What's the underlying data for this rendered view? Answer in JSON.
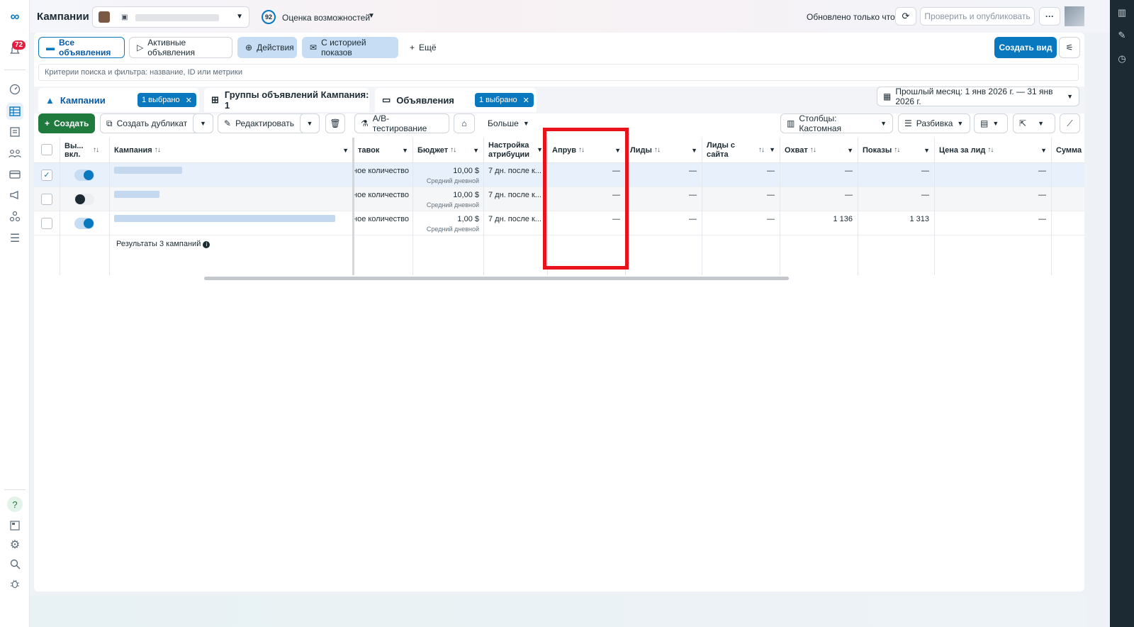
{
  "left_rail": {
    "notification_count": "72"
  },
  "topbar": {
    "title": "Кампании",
    "opportunity_score": "92",
    "opportunity_label": "Оценка возможностей",
    "updated_text": "Обновлено только что",
    "publish_label": "Проверить и опубликовать",
    "more_label": "···"
  },
  "filters": {
    "all_ads": "Все объявления",
    "active_ads": "Активные объявления",
    "actions": "Действия",
    "with_history": "С историей показов",
    "more": "Ещё",
    "create_view": "Создать вид",
    "search_placeholder": "Критерии поиска и фильтра: название, ID или метрики"
  },
  "level_tabs": {
    "campaigns": "Кампании",
    "campaigns_chip": "1 выбрано",
    "adsets": "Группы объявлений Кампания: 1",
    "ads": "Объявления",
    "ads_chip": "1 выбрано",
    "date_range": "Прошлый месяц: 1 янв 2026 г. — 31 янв 2026 г."
  },
  "toolbar": {
    "create": "Создать",
    "duplicate": "Создать дубликат",
    "edit": "Редактировать",
    "ab_test": "A/B-тестирование",
    "more": "Больше",
    "columns": "Столбцы: Кастомная",
    "breakdown": "Разбивка"
  },
  "table": {
    "headers": {
      "onoff": "Вы... вкл.",
      "campaign": "Кампания",
      "bid": "тавок",
      "budget": "Бюджет",
      "attribution": "Настройка атрибуции",
      "approve": "Апрув",
      "leads": "Лиды",
      "site_leads": "Лиды с сайта",
      "reach": "Охват",
      "impressions": "Показы",
      "cpl": "Цена за лид",
      "spend": "Сумма"
    },
    "rows": [
      {
        "bid": "ное количество",
        "budget": "10,00 $",
        "budget_sub": "Средний дневной",
        "attribution": "7 дн. после к...",
        "approve": "—",
        "leads": "—",
        "site_leads": "—",
        "reach": "—",
        "impressions": "—",
        "cpl": "—"
      },
      {
        "bid": "ное количество",
        "budget": "10,00 $",
        "budget_sub": "Средний дневной",
        "attribution": "7 дн. после к...",
        "approve": "—",
        "leads": "—",
        "site_leads": "—",
        "reach": "—",
        "impressions": "—",
        "cpl": "—"
      },
      {
        "bid": "ное количество",
        "budget": "1,00 $",
        "budget_sub": "Средний дневной",
        "attribution": "7 дн. после к...",
        "approve": "—",
        "leads": "—",
        "site_leads": "—",
        "reach": "1 136",
        "impressions": "1 313",
        "cpl": "—"
      }
    ],
    "results_text": "Результаты 3 кампаний"
  },
  "colors": {
    "accent": "#0a78be",
    "create_green": "#1f7a3d",
    "highlight_red": "#e8121c"
  }
}
